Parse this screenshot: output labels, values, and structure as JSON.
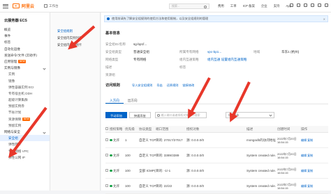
{
  "topbar": {
    "brand": "阿里云",
    "workbench": "工作台",
    "search_placeholder": "搜索...",
    "nav": [
      "费用",
      "工单",
      "ICP 备案",
      "企业",
      "支持",
      "App"
    ]
  },
  "sidebar": {
    "title": "云服务器 ECS",
    "items": [
      {
        "label": "概览",
        "type": "item"
      },
      {
        "label": "事件",
        "type": "item"
      },
      {
        "label": "标签",
        "type": "item"
      },
      {
        "label": "自动化运维",
        "type": "item"
      },
      {
        "label": "发送命令/文件 (云助手)",
        "type": "item"
      },
      {
        "label": "应用管理",
        "type": "item",
        "badge": "NEW"
      },
      {
        "label": "实例与镜像",
        "type": "group"
      },
      {
        "label": "实例",
        "type": "sub"
      },
      {
        "label": "镜像",
        "type": "sub"
      },
      {
        "label": "弹性容器实例 ECI",
        "type": "sub"
      },
      {
        "label": "专有宿主机 DDH",
        "type": "sub"
      },
      {
        "label": "超级计算集群",
        "type": "sub"
      },
      {
        "label": "预留实例券",
        "type": "sub"
      },
      {
        "label": "节省计划",
        "type": "sub"
      },
      {
        "label": "资源保障",
        "type": "sub",
        "badge": "NEW"
      },
      {
        "label": "预留实例",
        "type": "sub"
      },
      {
        "label": "网络与安全",
        "type": "group"
      },
      {
        "label": "安全组",
        "type": "sub",
        "active": true
      },
      {
        "label": "弹性网卡",
        "type": "sub"
      },
      {
        "label": "专有网络 VPC",
        "type": "sub"
      },
      {
        "label": "弹性公网 IP",
        "type": "sub"
      }
    ]
  },
  "panel2": {
    "items": [
      {
        "label": "安全组规则",
        "active": true
      },
      {
        "label": "安全组内实例列表",
        "active": false
      },
      {
        "label": "安全组内弹性网卡",
        "active": false
      }
    ]
  },
  "notice": {
    "text": "使用前请先了解安全组规则的使用方法和使用限制，以及安全组规则的管理"
  },
  "basic_info": {
    "title": "基本信息",
    "rows": [
      [
        {
          "k": "安全组ID/名称",
          "v": "sg-bp1f...",
          "link": false
        },
        {
          "k": "",
          "v": "",
          "link": false
        },
        {
          "k": "",
          "v": "",
          "link": false
        }
      ],
      [
        {
          "k": "安全组类型",
          "v": "普通安全组",
          "link": false
        },
        {
          "k": "所属专有网络",
          "v": "vpc-bp1...",
          "link": true
        },
        {
          "k": "地域",
          "v": "华东1 (杭州)",
          "link": false
        }
      ],
      [
        {
          "k": "网络类型",
          "v": "专有网络",
          "link": false
        },
        {
          "k": "组内互通策略",
          "v": "组内互通 设置组内互通策略",
          "link": true
        },
        {
          "k": "",
          "v": "",
          "link": false
        }
      ],
      [
        {
          "k": "描述",
          "v": "",
          "link": false
        },
        {
          "k": "标签",
          "v": "",
          "link": false
        },
        {
          "k": "",
          "v": "",
          "link": false
        }
      ],
      [
        {
          "k": "资源组",
          "v": "",
          "link": false
        },
        {
          "k": "",
          "v": "",
          "link": false
        },
        {
          "k": "",
          "v": "",
          "link": false
        }
      ]
    ]
  },
  "access_rules": {
    "title": "访问规则",
    "links": [
      "导入安全组规则",
      "导出",
      "还原规则",
      "链接修改"
    ],
    "tabs": [
      "入方向",
      "出方向"
    ],
    "add_button": "手动添加",
    "quick_button": "快速添加",
    "filter_placeholder": "输入端口或者授权对象进行搜索",
    "filter_select": "授权对象"
  },
  "table": {
    "headers": [
      "",
      "授权策略",
      "优先级",
      "协议类型",
      "端口范围",
      "授权对象",
      "",
      "描述",
      "创建时间",
      "操作"
    ],
    "rows": [
      {
        "policy": "允许",
        "priority": "1",
        "protocol": "自定义 TCP",
        "port": "目的: 27017/27017",
        "source": "源: 0.0.0.0/0",
        "desc": "mongodb的访问地址",
        "time": "2022年7月20日 16:54:15",
        "ops": "编辑 复制"
      },
      {
        "policy": "允许",
        "priority": "100",
        "protocol": "自定义 TCP",
        "port": "目的: 3389/3389",
        "source": "源: 0.0.0.0/0",
        "desc": "System created rule.",
        "time": "2022年7月20日 16:54:15",
        "ops": "编辑 复制"
      },
      {
        "policy": "允许",
        "priority": "100",
        "protocol": "全部 ICMP(IPv4)",
        "port": "目的: -1/-1",
        "source": "源: 0.0.0.0/0",
        "desc": "System created rule.",
        "time": "2022年7月20日 16:54:15",
        "ops": "编辑 复制"
      },
      {
        "policy": "允许",
        "priority": "100",
        "protocol": "自定义 TCP",
        "port": "目的: 22/22",
        "source": "源: 0.0.0.0/0",
        "desc": "System created rule.",
        "time": "2022年7月20日 16:54:15",
        "ops": "编辑 复制"
      }
    ]
  },
  "colors": {
    "accent": "#0064c8",
    "brand": "#ff6a00",
    "annotation_arrow": "#e8372a"
  }
}
